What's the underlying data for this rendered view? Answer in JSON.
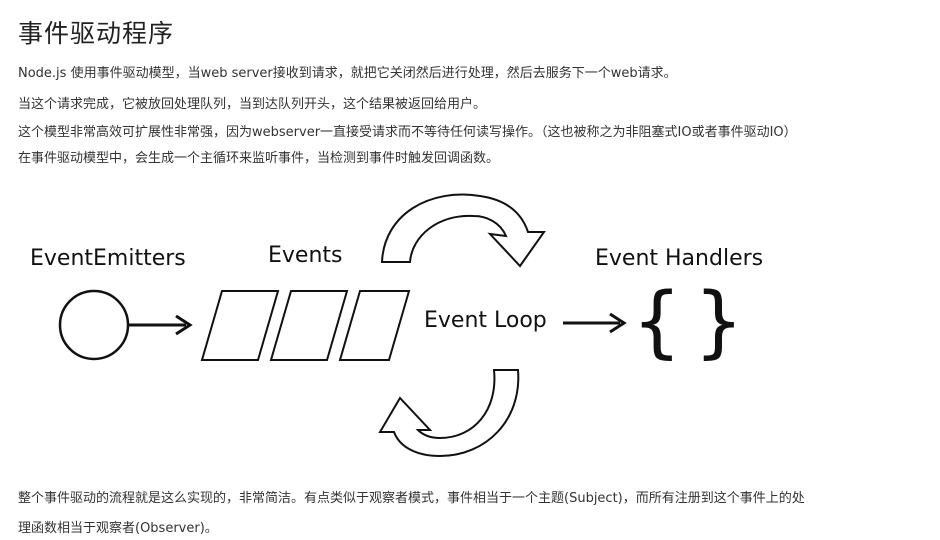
{
  "page": {
    "title": "事件驱动程序",
    "paragraphs": [
      "Node.js 使用事件驱动模型，当web server接收到请求，就把它关闭然后进行处理，然后去服务下一个web请求。",
      "当这个请求完成，它被放回处理队列，当到达队列开头，这个结果被返回给用户。",
      "这个模型非常高效可扩展性非常强，因为webserver一直接受请求而不等待任何读写操作。（这也被称之为非阻塞式IO或者事件驱动IO）",
      "在事件驱动模型中，会生成一个主循环来监听事件，当检测到事件时触发回调函数。"
    ],
    "closing": [
      "整个事件驱动的流程就是这么实现的，非常简洁。有点类似于观察者模式，事件相当于一个主题(Subject)，而所有注册到这个事件上的处",
      "理函数相当于观察者(Observer)。"
    ]
  },
  "diagram": {
    "emitters_label": "EventEmitters",
    "events_label": "Events",
    "loop_label": "Event Loop",
    "handlers_label": "Event Handlers",
    "brace_open": "{",
    "brace_close": "}"
  }
}
